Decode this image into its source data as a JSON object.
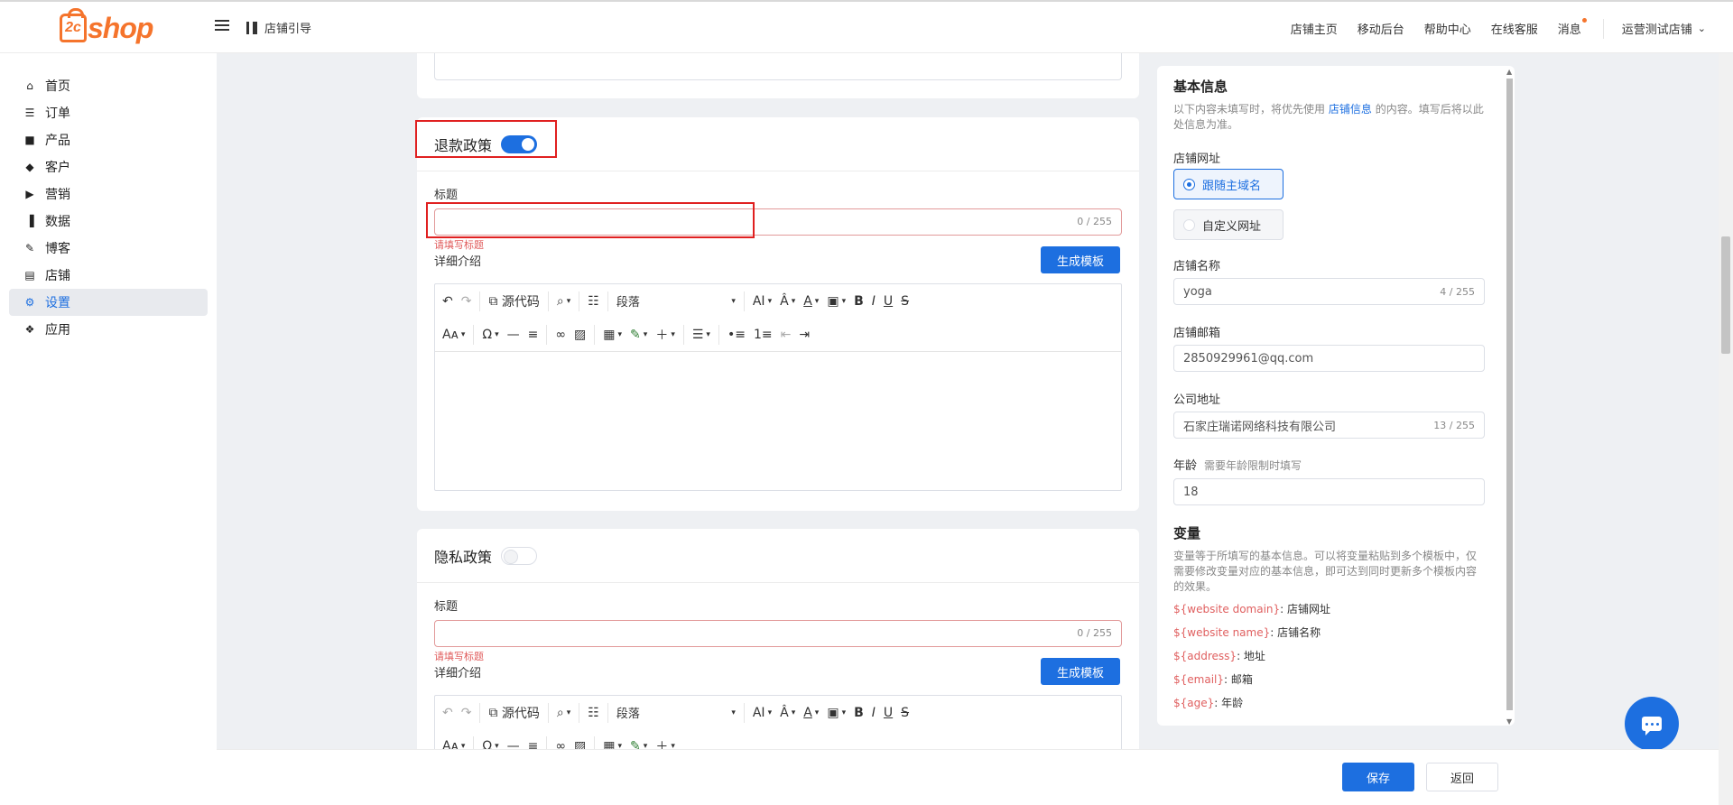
{
  "header": {
    "logo_text": "shop",
    "logo_mark": "2c",
    "guide_label": "店铺引导",
    "nav": [
      "店铺主页",
      "移动后台",
      "帮助中心",
      "在线客服"
    ],
    "messages_label": "消息",
    "store_label": "运营测试店铺"
  },
  "sidebar": {
    "items": [
      {
        "label": "首页",
        "icon": "home-icon"
      },
      {
        "label": "订单",
        "icon": "order-icon"
      },
      {
        "label": "产品",
        "icon": "bag-icon"
      },
      {
        "label": "客户",
        "icon": "diamond-icon"
      },
      {
        "label": "营销",
        "icon": "tag-icon"
      },
      {
        "label": "数据",
        "icon": "chart-icon"
      },
      {
        "label": "博客",
        "icon": "blog-icon"
      },
      {
        "label": "店铺",
        "icon": "store-icon"
      },
      {
        "label": "设置",
        "icon": "gear-icon",
        "active": true
      },
      {
        "label": "应用",
        "icon": "puzzle-icon"
      }
    ]
  },
  "refund_policy": {
    "title": "退款政策",
    "enabled": true,
    "title_field_label": "标题",
    "title_value": "",
    "title_count": "0 / 255",
    "title_error": "请填写标题",
    "detail_label": "详细介绍",
    "generate_button": "生成模板"
  },
  "privacy_policy": {
    "title": "隐私政策",
    "enabled": false,
    "title_field_label": "标题",
    "title_value": "",
    "title_count": "0 / 255",
    "title_error": "请填写标题",
    "detail_label": "详细介绍",
    "generate_button": "生成模板"
  },
  "editor": {
    "source_code": "源代码",
    "paragraph": "段落"
  },
  "basic_info": {
    "heading": "基本信息",
    "desc_before": "以下内容未填写时，将优先使用",
    "desc_link": "店铺信息",
    "desc_after": "的内容。填写后将以此处信息为准。",
    "domain_label": "店铺网址",
    "domain_options": [
      "跟随主域名",
      "自定义网址"
    ],
    "domain_selected": "跟随主域名",
    "name_label": "店铺名称",
    "name_value": "yoga",
    "name_count": "4 / 255",
    "email_label": "店铺邮箱",
    "email_value": "2850929961@qq.com",
    "address_label": "公司地址",
    "address_value": "石家庄瑞诺网络科技有限公司",
    "address_count": "13 / 255",
    "age_label": "年龄",
    "age_hint": "需要年龄限制时填写",
    "age_value": "18"
  },
  "variables": {
    "heading": "变量",
    "desc": "变量等于所填写的基本信息。可以将变量粘贴到多个模板中，仅需要修改变量对应的基本信息，即可达到同时更新多个模板内容的效果。",
    "items": [
      {
        "key": "${website domain}",
        "desc": ": 店铺网址"
      },
      {
        "key": "${website name}",
        "desc": ": 店铺名称"
      },
      {
        "key": "${address}",
        "desc": ": 地址"
      },
      {
        "key": "${email}",
        "desc": ": 邮箱"
      },
      {
        "key": "${age}",
        "desc": ": 年龄"
      }
    ]
  },
  "footer": {
    "save": "保存",
    "back": "返回"
  },
  "colors": {
    "accent": "#1d6fe0",
    "brand": "#f5742c",
    "error": "#e05b5b",
    "highlight_box": "#e02020"
  }
}
